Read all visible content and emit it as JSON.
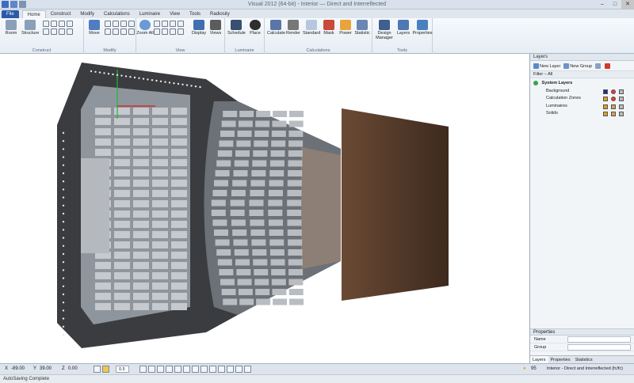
{
  "window": {
    "title": "Visual 2012 (64-bit) - Interior — Direct and Interreflected",
    "controls": [
      "–",
      "□",
      "✕"
    ]
  },
  "tabs": [
    {
      "label": "File"
    },
    {
      "label": "Home"
    },
    {
      "label": "Construct"
    },
    {
      "label": "Modify"
    },
    {
      "label": "Calculations"
    },
    {
      "label": "Luminaire"
    },
    {
      "label": "View"
    },
    {
      "label": "Tools"
    },
    {
      "label": "Radiosity"
    }
  ],
  "ribbon": {
    "groups": {
      "construct": "Construct",
      "modify": "Modify",
      "view": "View",
      "luminaire": "Luminaire",
      "calculations": "Calculations",
      "tools": "Tools"
    },
    "buttons": {
      "room": "Room",
      "structure": "Structure",
      "move": "Move",
      "zoom_all": "Zoom All",
      "display": "Display",
      "views": "Views",
      "schedule": "Schedule",
      "place": "Place",
      "calculate": "Calculate",
      "render": "Render",
      "standard": "Standard",
      "mask": "Mask",
      "power": "Power",
      "statistic": "Statistic",
      "design_manager": "Design Manager",
      "layers": "Layers",
      "properties": "Properties"
    },
    "icon_colors": {
      "room": "#8aa0b8",
      "structure": "#8aa0b8",
      "move": "#4f7cc4",
      "zoom": "#6b9ad4",
      "display": "#3f6fb0",
      "views": "#5c5c5c",
      "schedule": "#3a4f70",
      "place": "#2e2e2e",
      "calculate": "#5a76a8",
      "render": "#777777",
      "standard": "#b7c8de",
      "mask": "#c84a3a",
      "power": "#e8a33a",
      "statistic": "#6a86b2",
      "design_manager": "#3f5f8f",
      "layers": "#4e78b4",
      "properties": "#4a7fc0"
    }
  },
  "panel": {
    "title": "Layers",
    "new_layer": "New Layer",
    "new_group": "New Group",
    "filter_label": "Filter",
    "filter_value": "All",
    "system_layers": "System Layers",
    "layers": [
      {
        "name": "Background",
        "swatch": "#1f2f8f"
      },
      {
        "name": "Calculation Zones",
        "swatch": "#e0a020"
      },
      {
        "name": "Luminaires",
        "swatch": "#e0a020"
      },
      {
        "name": "Solids",
        "swatch": "#e0a020"
      }
    ],
    "properties_title": "Properties",
    "prop_name_label": "Name",
    "prop_group_label": "Group",
    "bottom_tabs": [
      "Layers",
      "Properties",
      "Statistics"
    ]
  },
  "status": {
    "x_label": "X",
    "x_value": "-89.00",
    "y_label": "Y",
    "y_value": "39.00",
    "z_label": "Z",
    "z_value": "0.00",
    "zoom_value": "0.5",
    "count": "95",
    "mode": "Interior - Direct and Interreflected (fc/fc)",
    "bottom_message": "AutoSaving Complete"
  }
}
